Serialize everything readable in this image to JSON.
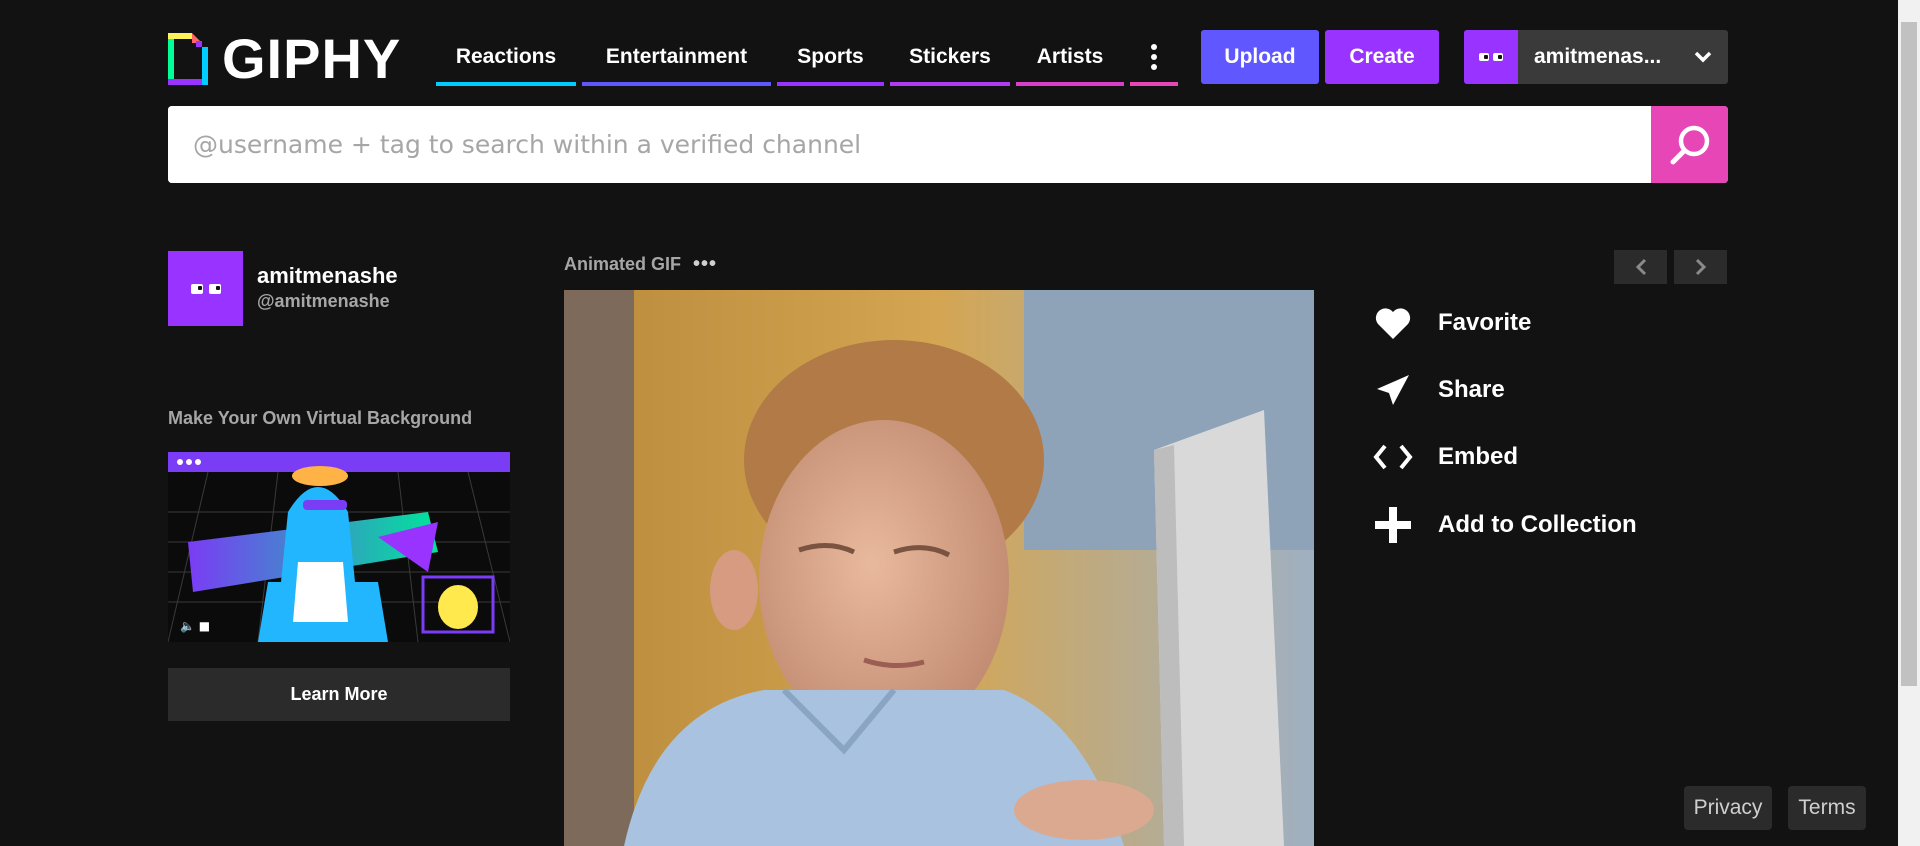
{
  "header": {
    "logo_text": "GIPHY",
    "nav": [
      {
        "label": "Reactions",
        "color": "#00ccff"
      },
      {
        "label": "Entertainment",
        "color": "#6157ff"
      },
      {
        "label": "Sports",
        "color": "#9933ff"
      },
      {
        "label": "Stickers",
        "color": "#9933ff"
      },
      {
        "label": "Artists",
        "color": "#e646b6"
      },
      {
        "label": "",
        "color": "#e646b6"
      }
    ],
    "upload_label": "Upload",
    "create_label": "Create",
    "username": "amitmenas..."
  },
  "search": {
    "placeholder": "@username + tag to search within a verified channel"
  },
  "channel": {
    "name": "amitmenashe",
    "handle": "@amitmenashe"
  },
  "promo": {
    "title": "Make Your Own Virtual Background",
    "button_label": "Learn More"
  },
  "gif": {
    "label": "Animated GIF",
    "more": "•••"
  },
  "actions": {
    "favorite": "Favorite",
    "share": "Share",
    "embed": "Embed",
    "add_to_collection": "Add to Collection"
  },
  "footer": {
    "privacy": "Privacy",
    "terms": "Terms"
  },
  "colors": {
    "background": "#121212",
    "upload": "#6157ff",
    "create": "#9933ff",
    "search_button": "#e646b6"
  }
}
